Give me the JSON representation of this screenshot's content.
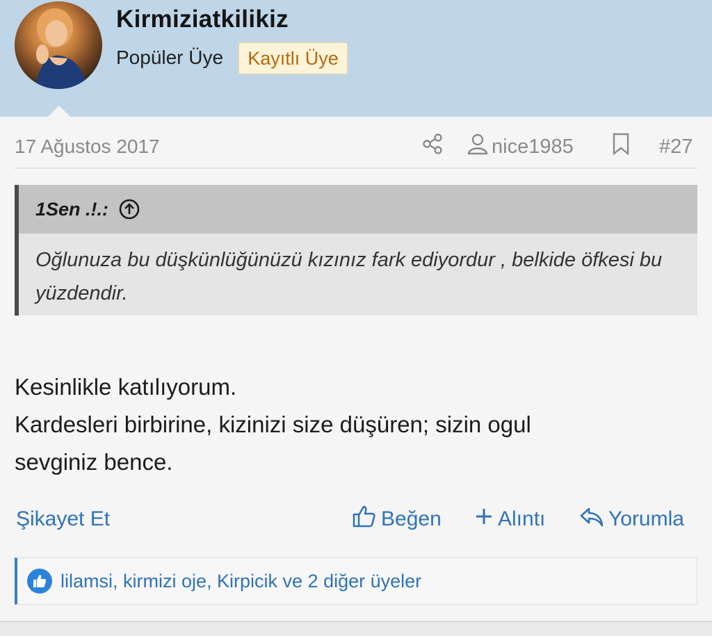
{
  "post": {
    "username": "Kirmiziatkilikiz",
    "rank": "Popüler Üye",
    "badge": "Kayıtlı Üye",
    "date": "17 Ağustos 2017",
    "author_link": "nice1985",
    "post_number": "#27"
  },
  "quote": {
    "author": "1Sen .!.:",
    "text": "Oğlunuza bu düşkünlüğünüzü kızınız fark ediyordur , belkide öfkesi bu yüzdendir."
  },
  "message": {
    "line1": "Kesinlikle katılıyorum.",
    "line2": "Kardesleri birbirine, kizinizi size düşüren; sizin ogul",
    "line3": "sevginiz bence."
  },
  "actions": {
    "report": "Şikayet Et",
    "like": "Beğen",
    "quote": "Alıntı",
    "reply": "Yorumla"
  },
  "reactions": {
    "text": "lilamsi, kirmizi oje, Kirpicik ve 2 diğer üyeler"
  },
  "icons": {
    "share": "share-icon",
    "user": "user-icon",
    "bookmark": "bookmark-icon",
    "quote_up": "arrow-up-circle-icon",
    "like": "thumbs-up-icon",
    "plus": "plus-icon",
    "reply": "reply-icon"
  },
  "colors": {
    "header_bg": "#bfd6e8",
    "link": "#2f73b8",
    "badge_text": "#b36a0e",
    "badge_bg": "#fdf3d8"
  }
}
